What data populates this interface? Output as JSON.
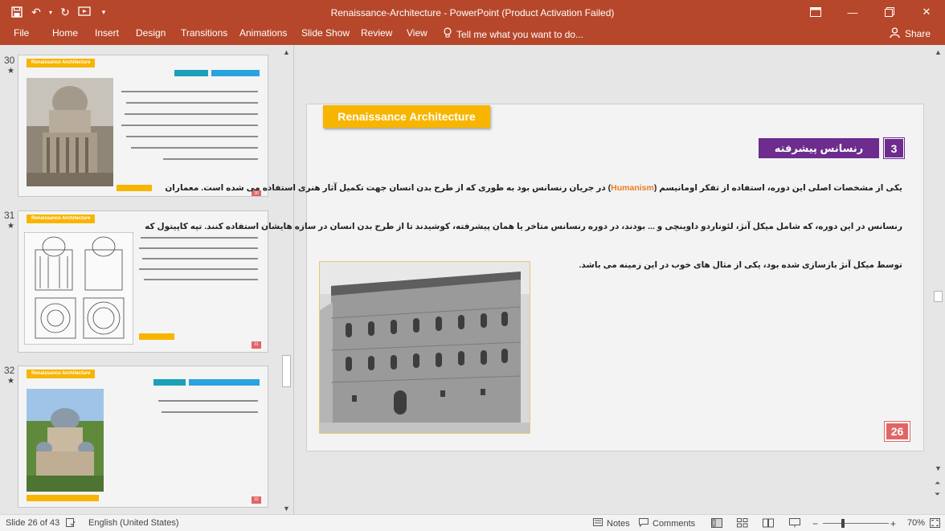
{
  "window": {
    "title": "Renaissance-Architecture - PowerPoint (Product Activation Failed)"
  },
  "ribbon": {
    "tabs": [
      "File",
      "Home",
      "Insert",
      "Design",
      "Transitions",
      "Animations",
      "Slide Show",
      "Review",
      "View"
    ],
    "tell_me": "Tell me what you want to do...",
    "share": "Share"
  },
  "thumbnails": [
    {
      "number": "30",
      "tag": "Renaissance Architecture",
      "badge": "30"
    },
    {
      "number": "31",
      "tag": "Renaissance Architecture",
      "badge": "31"
    },
    {
      "number": "32",
      "tag": "Renaissance Architecture",
      "badge": "32"
    }
  ],
  "slide": {
    "tag": "Renaissance Architecture",
    "heading": "رنسانس پیشرفته",
    "heading_number": "3",
    "line1_a": "یکی از مشخصات اصلی این دوره، استفاده از تفکر اومانیسم (",
    "line1_hl": "Humanism",
    "line1_b": ") در جریان رنسانس بود به طوری که از طرح بدن انسان جهت تکمیل آثار هنری استفاده می شده است. معماران",
    "line2": "رنسانس در این دوره، که شامل میکل آنژ، لئوناردو داوینچی و ... بودند، در دوره رنسانس متاخر یا همان پیشرفته، کوشیدند تا از طرح بدن انسان در سازه هایشان استفاده کنند. تپه کاپیتول که",
    "line3": "توسط میکل آنژ بازسازی شده بود، یکی از مثال های خوب در این زمینه می باشد.",
    "page_number": "26"
  },
  "status": {
    "slide_info": "Slide 26 of 43",
    "language": "English (United States)",
    "notes": "Notes",
    "comments": "Comments",
    "zoom": "70%"
  },
  "colors": {
    "accent": "#b7472a",
    "tag_yellow": "#f7b500",
    "heading_purple": "#6d2c8e",
    "badge_red": "#e06666",
    "highlight_orange": "#e67e22"
  }
}
